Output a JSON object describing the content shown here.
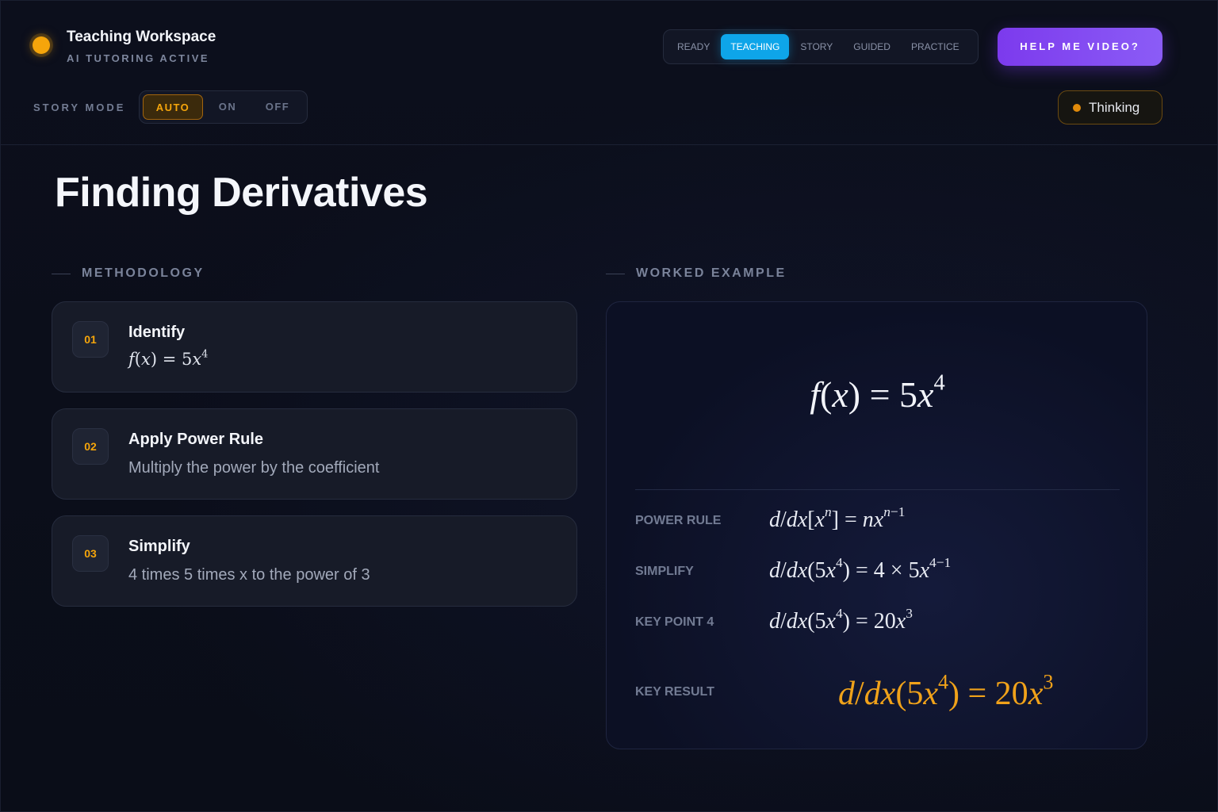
{
  "header": {
    "title": "Teaching Workspace",
    "subtitle": "AI TUTORING ACTIVE",
    "modes": [
      "READY",
      "TEACHING",
      "STORY",
      "GUIDED",
      "PRACTICE"
    ],
    "active_mode": "TEACHING",
    "help_button": "HELP ME VIDEO?",
    "status": "Thinking",
    "accent": "#0ea5e9",
    "brand_color": "#f5a50b",
    "help_color": "#7c3aed"
  },
  "story_mode": {
    "label": "STORY MODE",
    "options": [
      "AUTO",
      "ON",
      "OFF"
    ],
    "selected": "AUTO"
  },
  "page": {
    "title": "Finding Derivatives"
  },
  "methodology": {
    "heading": "METHODOLOGY",
    "steps": [
      {
        "num": "01",
        "title": "Identify",
        "math": "f(x) = 5x^4"
      },
      {
        "num": "02",
        "title": "Apply Power Rule",
        "desc": "Multiply the power by the coefficient"
      },
      {
        "num": "03",
        "title": "Simplify",
        "desc": "4 times 5 times x to the power of 3"
      }
    ]
  },
  "worked_example": {
    "heading": "WORKED EXAMPLE",
    "main_expression": "f(x) = 5x^4",
    "rows": [
      {
        "label": "POWER RULE",
        "math": "d/dx[x^n] = nx^(n−1)"
      },
      {
        "label": "SIMPLIFY",
        "math": "d/dx(5x^4) = 4 × 5x^(4−1)"
      },
      {
        "label": "KEY POINT 4",
        "math": "d/dx(5x^4) = 20x^3"
      }
    ],
    "result": {
      "label": "KEY RESULT",
      "math": "d/dx(5x^4) = 20x^3"
    },
    "result_color": "#f0a21a"
  }
}
